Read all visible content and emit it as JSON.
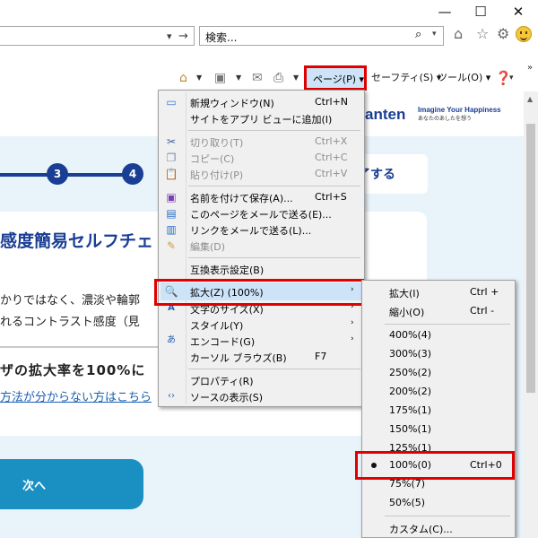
{
  "window": {
    "minimize": "—",
    "maximize": "☐",
    "close": "✕"
  },
  "address": {
    "dropdown": "▾",
    "go": "→"
  },
  "search": {
    "placeholder": "検索...",
    "icon": "⌕",
    "dropdown": "▾"
  },
  "top_icons": {
    "home": "⌂",
    "favorites": "☆",
    "settings": "⚙"
  },
  "commandbar": {
    "page_label": "ページ(P) ▾",
    "safety_label": "セーフティ(S) ▾",
    "tools_label": "ツール(O) ▾",
    "help_label": "▾",
    "more": "»"
  },
  "site": {
    "logo": "anten",
    "tagline": "Imagine Your Happiness",
    "tagline_sub": "あなたのあしたを想う",
    "steps": [
      "3",
      "4"
    ],
    "finish": "終了する",
    "heading": "感度簡易セルフチェ",
    "line1": "かりではなく、濃淡や輪郭",
    "line2": "れるコントラスト感度（見",
    "zoom_note": "ザの拡大率を100%に",
    "help_link": "方法が分からない方はこちら",
    "next": "次へ"
  },
  "page_menu": {
    "new_window": {
      "label": "新規ウィンドウ(N)",
      "shortcut": "Ctrl+N"
    },
    "add_app_view": {
      "label": "サイトをアプリ ビューに追加(I)"
    },
    "cut": {
      "label": "切り取り(T)",
      "shortcut": "Ctrl+X"
    },
    "copy": {
      "label": "コピー(C)",
      "shortcut": "Ctrl+C"
    },
    "paste": {
      "label": "貼り付け(P)",
      "shortcut": "Ctrl+V"
    },
    "save_as": {
      "label": "名前を付けて保存(A)...",
      "shortcut": "Ctrl+S"
    },
    "send_page": {
      "label": "このページをメールで送る(E)..."
    },
    "send_link": {
      "label": "リンクをメールで送る(L)..."
    },
    "edit": {
      "label": "編集(D)"
    },
    "compat": {
      "label": "互換表示設定(B)"
    },
    "zoom": {
      "label": "拡大(Z) (100%)"
    },
    "text_size": {
      "label": "文字のサイズ(X)"
    },
    "style": {
      "label": "スタイル(Y)"
    },
    "encoding": {
      "label": "エンコード(G)"
    },
    "caret": {
      "label": "カーソル ブラウズ(B)",
      "shortcut": "F7"
    },
    "properties": {
      "label": "プロパティ(R)"
    },
    "view_source": {
      "label": "ソースの表示(S)"
    }
  },
  "zoom_menu": {
    "zoom_in": {
      "label": "拡大(I)",
      "shortcut": "Ctrl +"
    },
    "zoom_out": {
      "label": "縮小(O)",
      "shortcut": "Ctrl -"
    },
    "levels": [
      "400%(4)",
      "300%(3)",
      "250%(2)",
      "200%(2)",
      "175%(1)",
      "150%(1)",
      "125%(1)"
    ],
    "current": {
      "label": "100%(0)",
      "shortcut": "Ctrl+0"
    },
    "lower": [
      "75%(7)",
      "50%(5)"
    ],
    "custom": {
      "label": "カスタム(C)..."
    }
  },
  "colors": {
    "brand": "#1a3e94",
    "highlight": "#cde3f7",
    "annotation": "#e00000"
  }
}
